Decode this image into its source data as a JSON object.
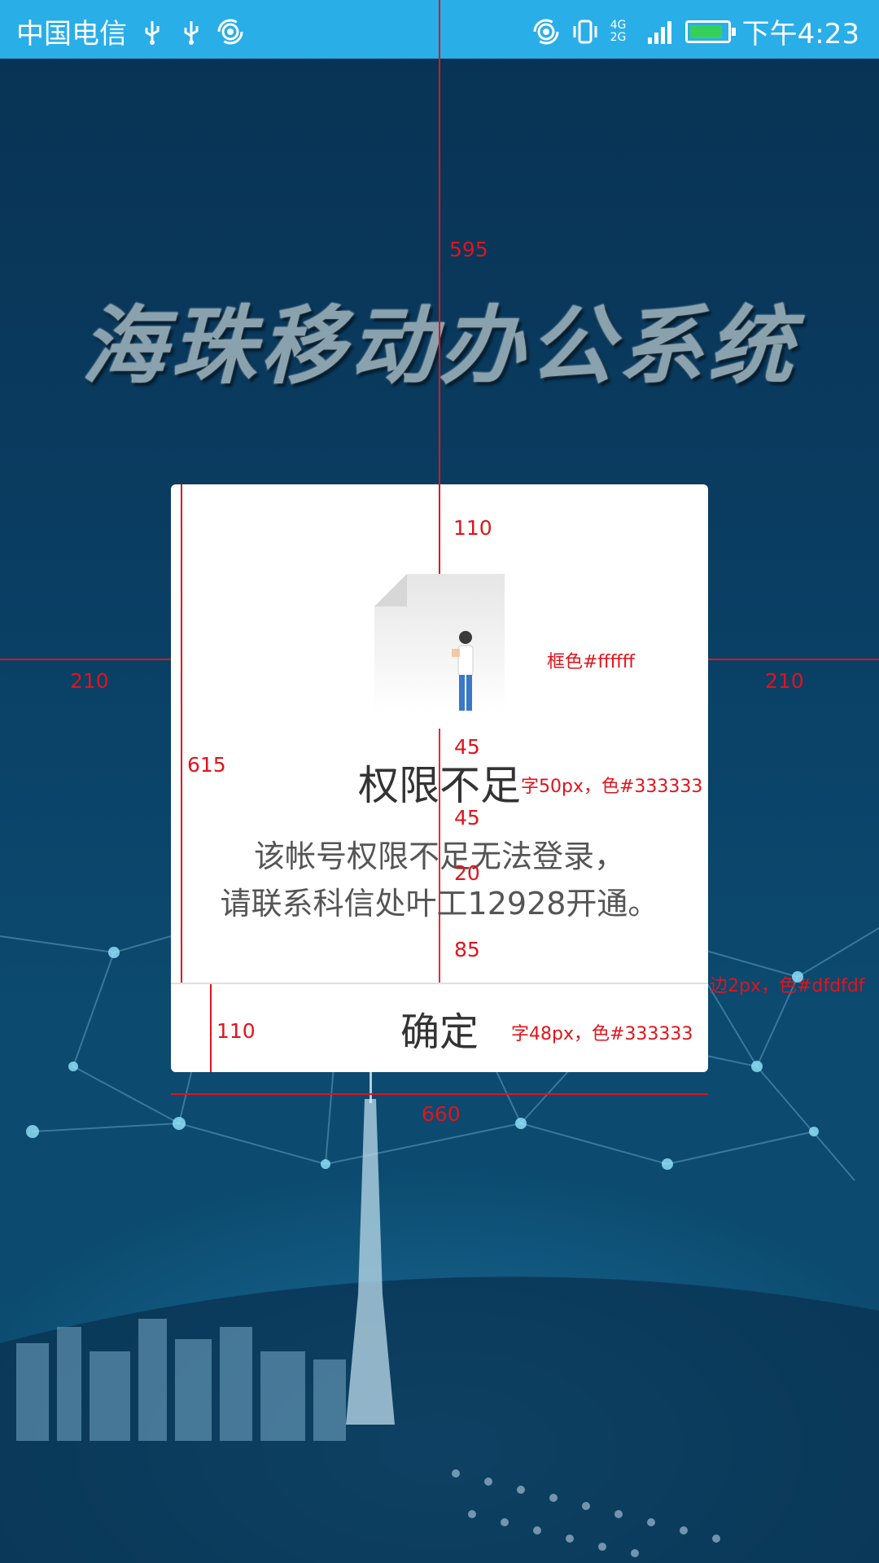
{
  "status_bar": {
    "carrier": "中国电信",
    "time": "下午4:23",
    "network": "4G 2G",
    "icons": [
      "usb-icon",
      "usb-icon",
      "hotspot-icon",
      "hotspot-icon",
      "vibrate-icon",
      "signal-icon",
      "battery-icon"
    ]
  },
  "app": {
    "title": "海珠移动办公系统"
  },
  "dialog": {
    "title": "权限不足",
    "message_line1": "该帐号权限不足无法登录，",
    "message_line2": "请联系科信处叶工12928开通。",
    "confirm_label": "确定"
  },
  "annotations": {
    "top_offset": "595",
    "side_left": "210",
    "side_right": "210",
    "inner_top": "110",
    "frame_color": "框色#ffffff",
    "dialog_height": "615",
    "gap_icon_title": "45",
    "title_spec": "字50px，色#333333",
    "gap_title_msg": "45",
    "line_gap": "20",
    "gap_bottom": "85",
    "divider_spec": "边2px，色#dfdfdf",
    "button_height": "110",
    "button_spec": "字48px，色#333333",
    "dialog_width": "660"
  },
  "colors": {
    "status_bar": "#29aee8",
    "dialog_bg": "#ffffff",
    "text_primary": "#333333",
    "divider": "#dfdfdf",
    "annotation": "#e0141c"
  }
}
